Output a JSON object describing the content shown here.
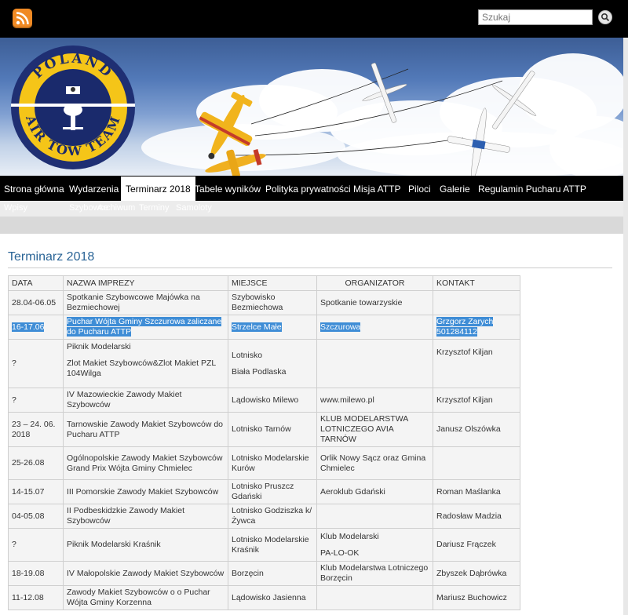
{
  "search": {
    "placeholder": "Szukaj"
  },
  "nav": {
    "items": [
      {
        "label": "Strona główna"
      },
      {
        "label": "Wydarzenia"
      },
      {
        "label": "Terminarz 2018",
        "active": true
      },
      {
        "label": "Tabele wyników"
      },
      {
        "label": "Polityka prywatności"
      },
      {
        "label": "Misja ATTP"
      },
      {
        "label": "Piloci"
      },
      {
        "label": "Galerie"
      },
      {
        "label": "Regulamin Pucharu ATTP"
      }
    ]
  },
  "subnav": {
    "items": [
      {
        "label": "Wpisy"
      },
      {
        "label": "Szybowce"
      },
      {
        "label": "Archiwum"
      },
      {
        "label": "Terminy"
      },
      {
        "label": "Samoloty"
      }
    ]
  },
  "logo": {
    "top_text": "POLAND",
    "bottom_text": "AIR TOW TEAM",
    "colors": {
      "ring": "#1f2f73",
      "band": "#f5c518",
      "core": "#1a2a6c"
    }
  },
  "page": {
    "title": "Terminarz 2018"
  },
  "table": {
    "headers": [
      "DATA",
      "NAZWA IMPREZY",
      "MIEJSCE",
      "ORGANIZATOR",
      "KONTAKT"
    ],
    "rows": [
      {
        "data": "28.04-06.05",
        "nazwa": "Spotkanie Szybowcowe Majówka na Bezmiechowej",
        "miejsce": "Szybowisko Bezmiechowa",
        "organizator": "Spotkanie towarzyskie",
        "kontakt": ""
      },
      {
        "data": "16-17.06",
        "nazwa": "Puchar Wójta Gminy Szczurowa zaliczane do Pucharu ATTP",
        "miejsce": "Strzelce Małe",
        "organizator": "Szczurowa",
        "kontakt": "Grzgorz Zarych 501284112"
      },
      {
        "data": "?",
        "nazwa": "Piknik Modelarski",
        "nazwa2": "Zlot Makiet Szybowców&Zlot Makiet PZL 104Wilga",
        "miejsce": "Lotnisko",
        "miejsce2": "Biała Podlaska",
        "organizator": "",
        "kontakt": "Krzysztof Kiljan"
      },
      {
        "data": "?",
        "nazwa": "IV Mazowieckie Zawody Makiet Szybowców",
        "miejsce": "Lądowisko Milewo",
        "organizator": "www.milewo.pl",
        "kontakt": "Krzysztof Kiljan"
      },
      {
        "data": "23 – 24. 06. 2018",
        "nazwa": "Tarnowskie Zawody Makiet Szybowców do Pucharu ATTP",
        "miejsce": "Lotnisko Tarnów",
        "organizator": "KLUB MODELARSTWA LOTNICZEGO AVIA TARNÓW",
        "kontakt": "Janusz Olszówka"
      },
      {
        "data": "25-26.08",
        "nazwa": "Ogólnopolskie Zawody Makiet Szybowców Grand Prix Wójta Gminy Chmielec",
        "miejsce": "Lotnisko Modelarskie Kurów",
        "organizator": "Orlik Nowy Sącz oraz Gmina Chmielec",
        "kontakt": ""
      },
      {
        "data": "14-15.07",
        "nazwa": "III Pomorskie Zawody Makiet Szybowców",
        "miejsce": "Lotnisko Pruszcz Gdański",
        "organizator": "Aeroklub Gdański",
        "kontakt": "Roman Maślanka"
      },
      {
        "data": "04-05.08",
        "nazwa": "II Podbeskidzkie Zawody Makiet Szybowców",
        "miejsce": "Lotnisko Godziszka k/ Żywca",
        "organizator": "",
        "kontakt": " Radosław Madzia"
      },
      {
        "data": "?",
        "nazwa": "Piknik Modelarski Kraśnik",
        "miejsce": "Lotnisko Modelarskie Kraśnik",
        "organizator": "Klub Modelarski",
        "organizator2": "PA-LO-OK",
        "kontakt": "Dariusz Frączek"
      },
      {
        "data": "18-19.08",
        "nazwa": "IV Małopolskie Zawody Makiet Szybowców",
        "miejsce": "Borzęcin",
        "organizator": " Klub Modelarstwa Lotniczego Borzęcin",
        "kontakt": "Zbyszek  Dąbrówka"
      },
      {
        "data": " 11-12.08",
        "nazwa": " Zawody Makiet Szybowców o o Puchar Wójta Gminy Korzenna",
        "miejsce": " Lądowisko Jasienna",
        "organizator": "",
        "kontakt": " Mariusz Buchowicz"
      }
    ]
  }
}
